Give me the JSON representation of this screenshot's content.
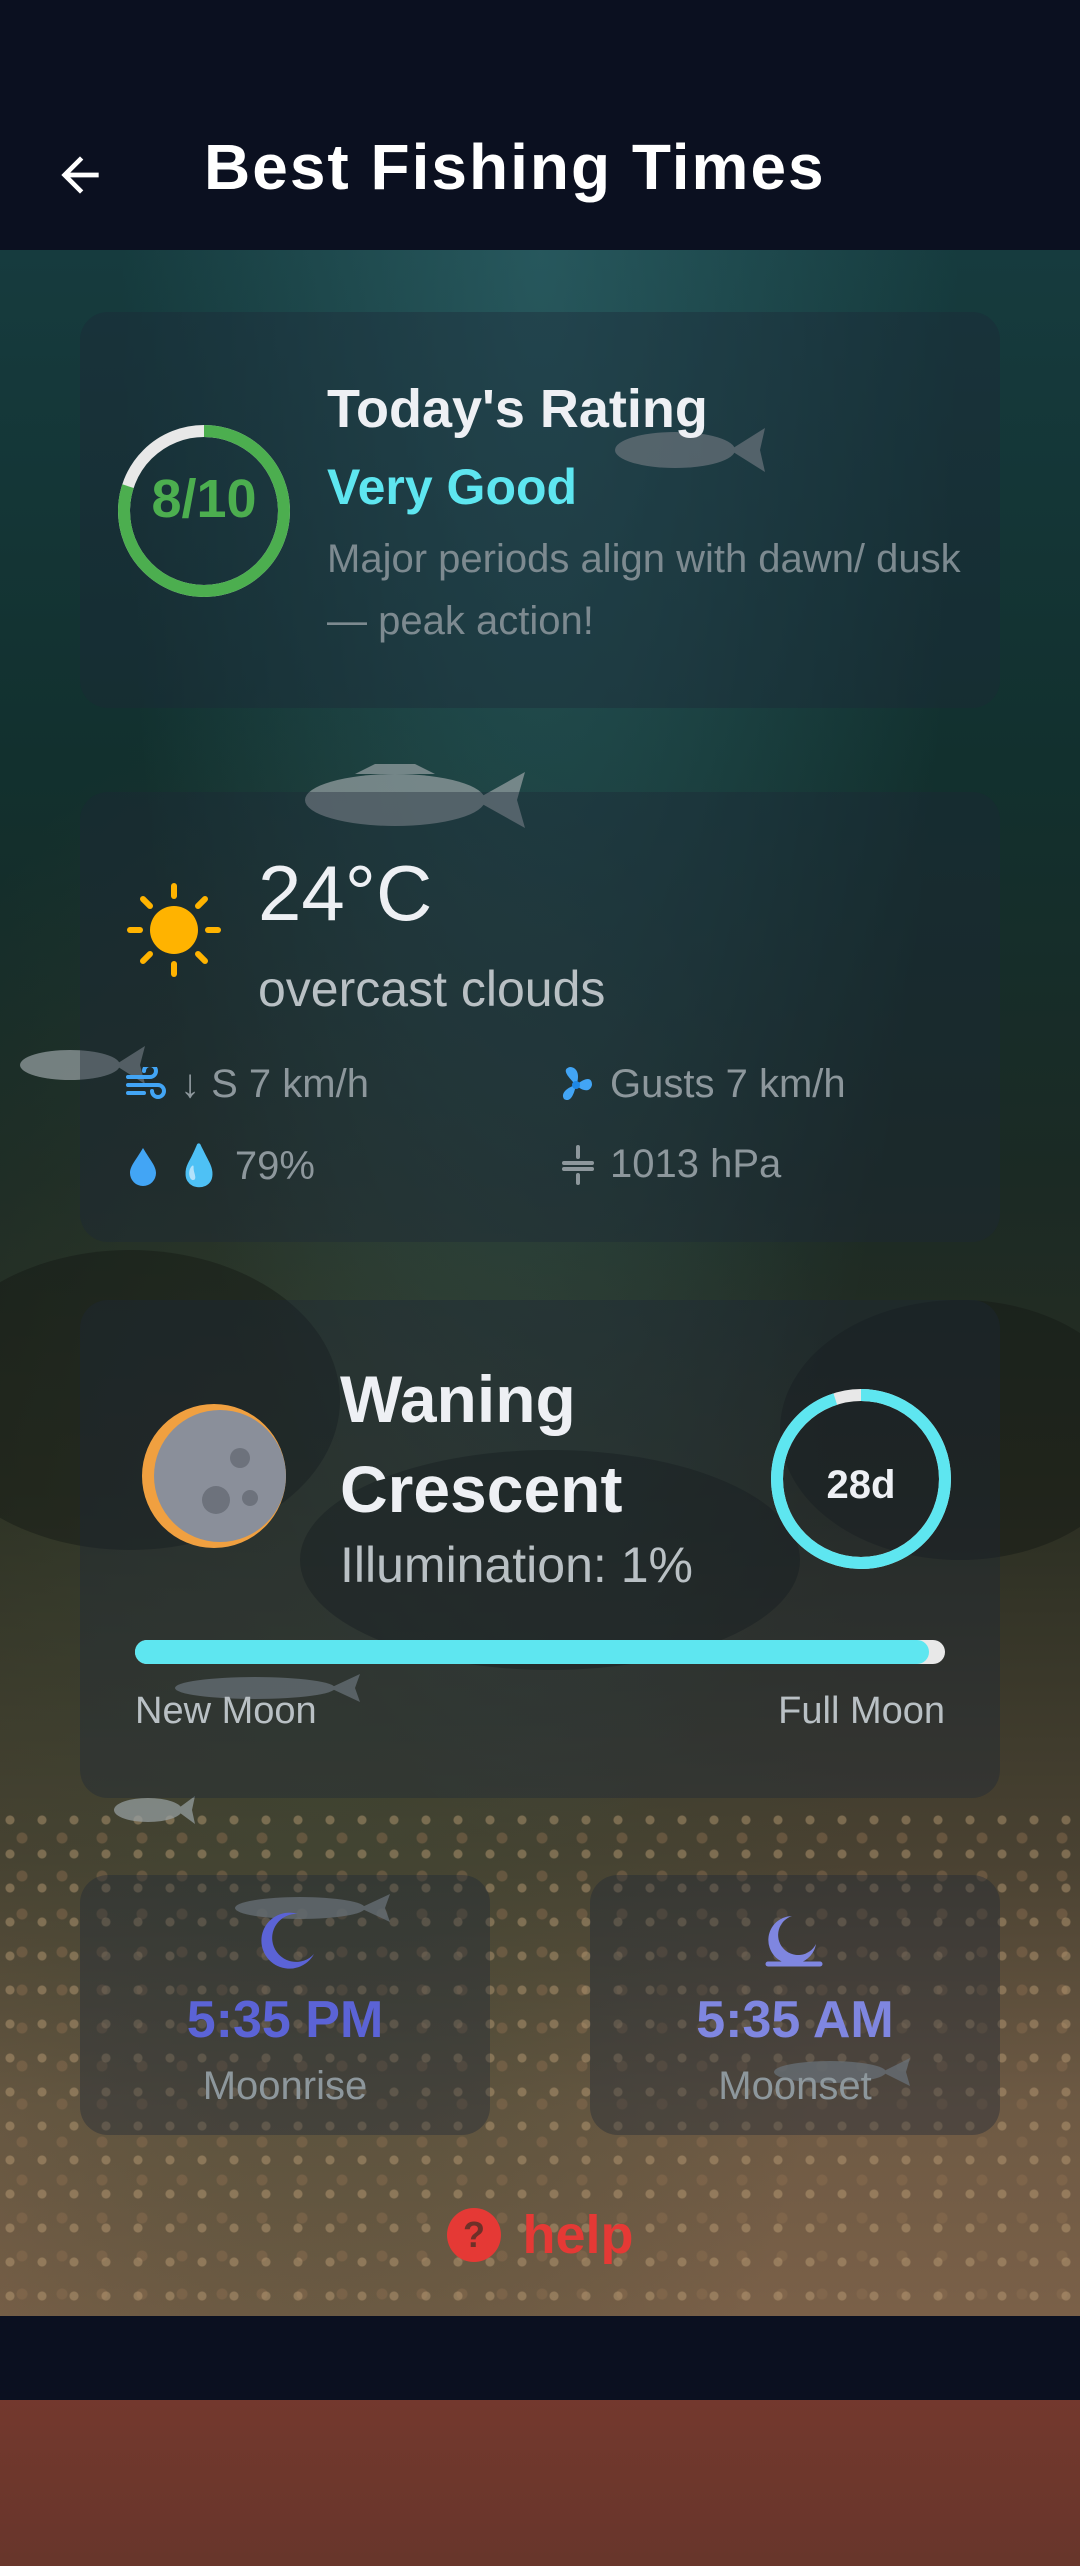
{
  "header": {
    "title": "Best Fishing Times",
    "back_icon": "arrow-left-icon"
  },
  "rating": {
    "score_text": "8/10",
    "score_fraction": 0.8,
    "title": "Today's Rating",
    "level": "Very Good",
    "description": "Major periods align with dawn/ dusk — peak action!",
    "ring_color": "#4cae4f",
    "level_color": "#5ee6f0"
  },
  "weather": {
    "icon": "sun-icon",
    "temperature": "24°C",
    "condition": "overcast clouds",
    "wind": "↓ S 7 km/h",
    "gusts": "Gusts 7 km/h",
    "humidity": "💧 79%",
    "pressure": "1013 hPa"
  },
  "moon": {
    "phase": "Waning Crescent",
    "illumination": "Illumination: 1%",
    "age": "28d",
    "age_fraction": 0.95,
    "cycle_progress": 0.98,
    "start_label": "New Moon",
    "end_label": "Full Moon",
    "accent": "#5ee6f0"
  },
  "moonrise": {
    "time": "5:35 PM",
    "label": "Moonrise",
    "icon": "crescent-moon-icon"
  },
  "moonset": {
    "time": "5:35 AM",
    "label": "Moonset",
    "icon": "moonset-icon"
  },
  "help": {
    "label": "help",
    "icon": "question-icon",
    "color": "#e53935"
  }
}
